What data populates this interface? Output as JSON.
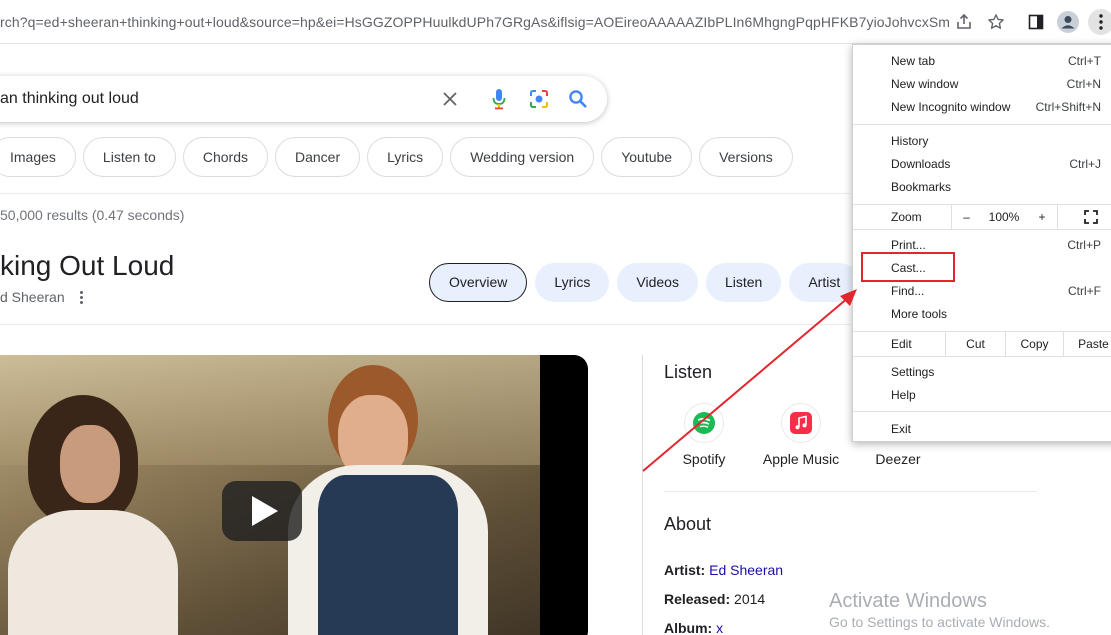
{
  "browser": {
    "url": "rch?q=ed+sheeran+thinking+out+loud&source=hp&ei=HsGGZOPPHuulkdUPh7GRgAs&iflsig=AOEireoAAAAAZIbPLIn6MhgngPqpHFKB7yioJohvcxSm..."
  },
  "search": {
    "query": "an thinking out loud",
    "chips": [
      "Images",
      "Listen to",
      "Chords",
      "Dancer",
      "Lyrics",
      "Wedding version",
      "Youtube",
      "Versions"
    ],
    "stats": "50,000 results (0.47 seconds)"
  },
  "knowledge_panel": {
    "title": "king Out Loud",
    "subtitle": "d Sheeran",
    "tabs": [
      "Overview",
      "Lyrics",
      "Videos",
      "Listen",
      "Artist"
    ],
    "listen_heading": "Listen",
    "services": [
      {
        "label": "Spotify",
        "icon": "spotify-icon",
        "color": "#1db954"
      },
      {
        "label": "Apple Music",
        "icon": "apple-music-icon",
        "color": "#fa2d48"
      },
      {
        "label": "Deezer",
        "icon": "deezer-icon",
        "color": "#000000"
      }
    ],
    "about_heading": "About",
    "facts": [
      {
        "label": "Artist:",
        "value": "Ed Sheeran",
        "link": true
      },
      {
        "label": "Released:",
        "value": "2014",
        "link": false
      },
      {
        "label": "Album:",
        "value": "x",
        "link": true
      }
    ]
  },
  "chrome_menu": {
    "group1": [
      {
        "label": "New tab",
        "shortcut": "Ctrl+T"
      },
      {
        "label": "New window",
        "shortcut": "Ctrl+N"
      },
      {
        "label": "New Incognito window",
        "shortcut": "Ctrl+Shift+N"
      }
    ],
    "group2": [
      {
        "label": "History",
        "submenu": true
      },
      {
        "label": "Downloads",
        "shortcut": "Ctrl+J"
      },
      {
        "label": "Bookmarks",
        "submenu": true
      }
    ],
    "zoom": {
      "label": "Zoom",
      "minus": "–",
      "value": "100%",
      "plus": "+"
    },
    "group3": [
      {
        "label": "Print...",
        "shortcut": "Ctrl+P"
      },
      {
        "label": "Cast..."
      },
      {
        "label": "Find...",
        "shortcut": "Ctrl+F"
      },
      {
        "label": "More tools",
        "submenu": true
      }
    ],
    "edit": {
      "label": "Edit",
      "cut": "Cut",
      "copy": "Copy",
      "paste": "Paste"
    },
    "group4": [
      {
        "label": "Settings"
      },
      {
        "label": "Help",
        "submenu": true
      }
    ],
    "exit": "Exit"
  },
  "annotation": {
    "color": "#e3262e"
  },
  "watermark": {
    "title": "Activate Windows",
    "subtitle": "Go to Settings to activate Windows."
  }
}
